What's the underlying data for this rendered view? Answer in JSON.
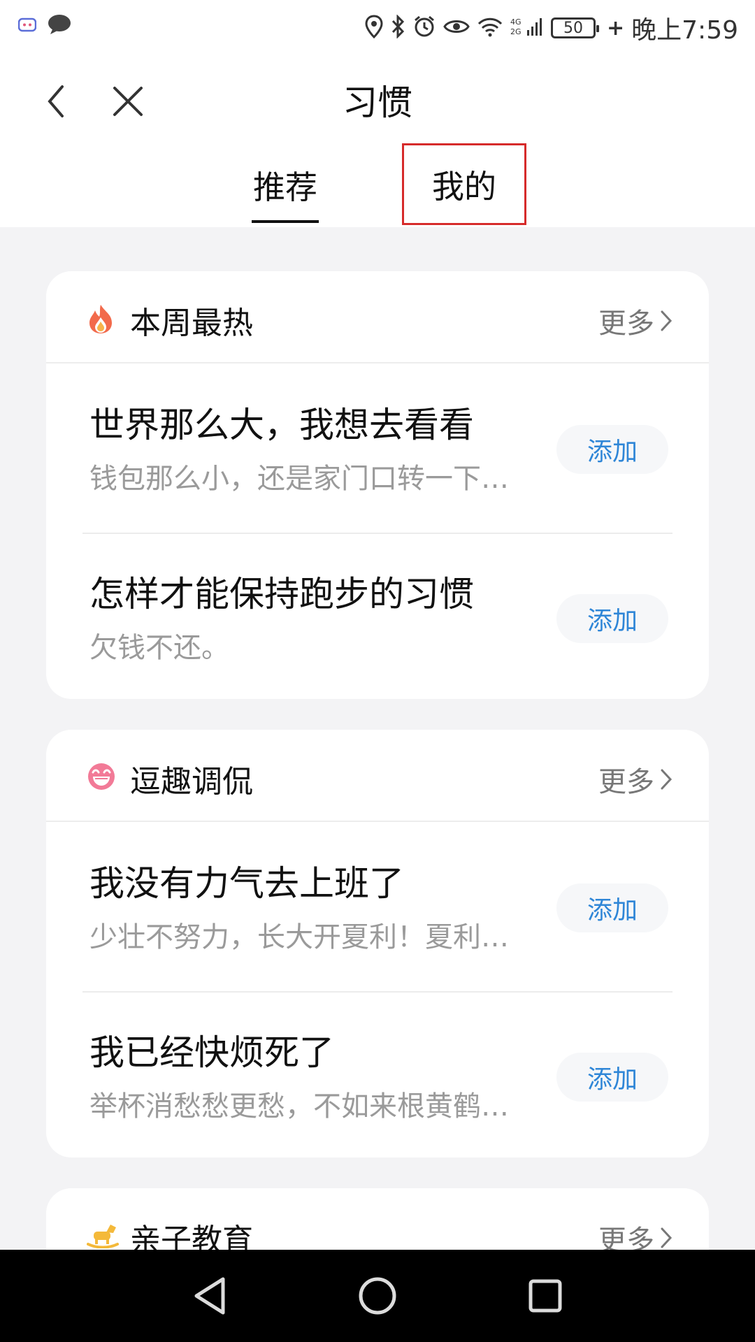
{
  "status_bar": {
    "time": "晚上7:59",
    "battery": "50",
    "icons": [
      "bot-icon",
      "chat-bubble-icon",
      "location-icon",
      "bluetooth-icon",
      "alarm-icon",
      "eye-icon",
      "wifi-icon",
      "signal-icon",
      "battery-icon"
    ]
  },
  "header": {
    "title": "习惯",
    "tabs": [
      {
        "label": "推荐",
        "active": true
      },
      {
        "label": "我的",
        "active": false,
        "highlighted": true
      }
    ],
    "highlight_color": "#d62b2b"
  },
  "sections": [
    {
      "title": "本周最热",
      "icon": "fire-icon",
      "more_label": "更多",
      "items": [
        {
          "title": "世界那么大，我想去看看",
          "subtitle": "钱包那么小，还是家门口转一下…",
          "action": "添加"
        },
        {
          "title": "怎样才能保持跑步的习惯",
          "subtitle": "欠钱不还。",
          "action": "添加"
        }
      ]
    },
    {
      "title": "逗趣调侃",
      "icon": "grin-face-icon",
      "more_label": "更多",
      "items": [
        {
          "title": "我没有力气去上班了",
          "subtitle": "少壮不努力，长大开夏利！夏利…",
          "action": "添加"
        },
        {
          "title": "我已经快烦死了",
          "subtitle": "举杯消愁愁更愁，不如来根黄鹤…",
          "action": "添加"
        }
      ]
    },
    {
      "title": "亲子教育",
      "icon": "rocking-horse-icon",
      "more_label": "更多",
      "items": []
    }
  ],
  "colors": {
    "accent": "#2f86d7",
    "background": "#f3f3f5",
    "card": "#ffffff",
    "subtitle": "#9a9a9a"
  },
  "nav_bar": {
    "buttons": [
      "back-triangle-icon",
      "home-circle-icon",
      "recent-square-icon"
    ]
  }
}
